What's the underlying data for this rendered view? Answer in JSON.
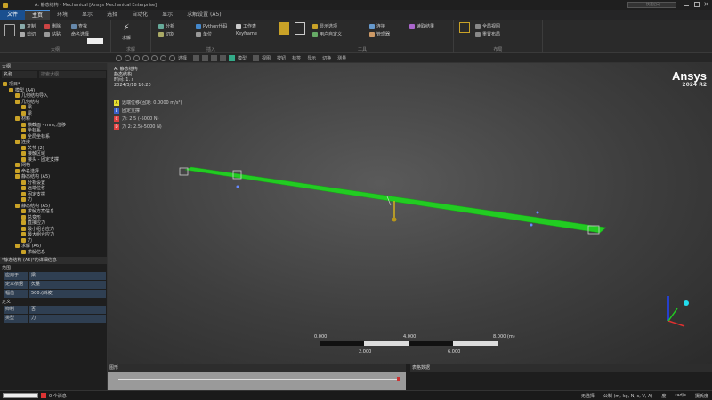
{
  "window": {
    "title": "A: 静态结构 - Mechanical [Ansys Mechanical Enterprise]",
    "search_placeholder": "快速启动"
  },
  "menu": {
    "file": "文件",
    "tabs": [
      "主页",
      "环境",
      "显示",
      "选择",
      "自动化",
      "显示",
      "求解设置 (A5)"
    ]
  },
  "ribbon": {
    "groups": [
      "大纲",
      "求解",
      "插入",
      "工具",
      "布局"
    ],
    "items": [
      "复制",
      "剪切",
      "删除",
      "粘贴",
      "查找",
      "命名选择",
      "求解",
      "分析",
      "切割",
      "Python代码",
      "单位",
      "工作表",
      "Keyframe",
      "显示选项",
      "用户自定义",
      "连接",
      "管理器",
      "读取结果",
      "全局视图",
      "重置布局"
    ]
  },
  "toolbar": {
    "labels": [
      "选择",
      "模型",
      "视图",
      "按钮",
      "标签",
      "显示",
      "切换",
      "测量"
    ]
  },
  "outline": {
    "header": "大纲",
    "filter_label": "名称",
    "search_placeholder": "搜索大纲",
    "items": [
      {
        "label": "项目*",
        "indent": 0
      },
      {
        "label": "模型 (A4)",
        "indent": 1
      },
      {
        "label": "几何结构导入",
        "indent": 2
      },
      {
        "label": "几何结构",
        "indent": 2
      },
      {
        "label": "梁",
        "indent": 3
      },
      {
        "label": "梁",
        "indent": 3
      },
      {
        "label": "材料",
        "indent": 2
      },
      {
        "label": "横截面 - mm,,位移",
        "indent": 3
      },
      {
        "label": "坐标系",
        "indent": 3
      },
      {
        "label": "全局坐标系",
        "indent": 3
      },
      {
        "label": "连接",
        "indent": 2
      },
      {
        "label": "关节 (2)",
        "indent": 3
      },
      {
        "label": "接触区域",
        "indent": 3
      },
      {
        "label": "接头 - 固定支撑",
        "indent": 3
      },
      {
        "label": "网格",
        "indent": 2
      },
      {
        "label": "命名选择",
        "indent": 2
      },
      {
        "label": "静态结构 (A5)",
        "indent": 2
      },
      {
        "label": "分析设置",
        "indent": 3
      },
      {
        "label": "远端位移",
        "indent": 3
      },
      {
        "label": "固定支撑",
        "indent": 3
      },
      {
        "label": "力",
        "indent": 3
      },
      {
        "label": "静态结构 (A5)",
        "indent": 2
      },
      {
        "label": "求解方案信息",
        "indent": 3
      },
      {
        "label": "总变形",
        "indent": 3
      },
      {
        "label": "直接应力",
        "indent": 3
      },
      {
        "label": "最小组合应力",
        "indent": 3
      },
      {
        "label": "最大组合应力",
        "indent": 3
      },
      {
        "label": "力",
        "indent": 3
      },
      {
        "label": "求解 (A6)",
        "indent": 2
      },
      {
        "label": "求解信息",
        "indent": 3
      }
    ]
  },
  "details": {
    "header": "\"静态结构 (A5)\"的详细信息",
    "sections": [
      {
        "title": "范围",
        "rows": [
          {
            "k": "应用于",
            "v": "梁"
          },
          {
            "k": "定义依据",
            "v": "矢量"
          },
          {
            "k": "幅值",
            "v": "500.(斜坡)"
          }
        ]
      },
      {
        "title": "定义",
        "rows": [
          {
            "k": "抑制",
            "v": "否"
          },
          {
            "k": "类型",
            "v": "力"
          }
        ]
      }
    ]
  },
  "viewport": {
    "title_lines": [
      "A: 静态结构",
      "静态结构",
      "时间: 1. s",
      "2024/3/18 10:23"
    ],
    "legend": [
      {
        "tag": "A",
        "label": "远端位移(固定: 0.0000 m/s²)",
        "color": "#e8e030"
      },
      {
        "tag": "B",
        "label": "固定支撑",
        "color": "#3a5fc8"
      },
      {
        "tag": "C",
        "label": "力: 2.5 (-5000 N)",
        "color": "#e04040"
      },
      {
        "tag": "D",
        "label": "力 2: 2.5(-5000 N)",
        "color": "#e04040"
      }
    ],
    "brand": "Ansys",
    "version": "2024 R2",
    "scale_top": [
      "0.000",
      "4.000",
      "8.000 (m)"
    ],
    "scale_bottom": [
      "2.000",
      "6.000"
    ]
  },
  "bottom": {
    "graph_label": "图形",
    "table_label": "表格数据"
  },
  "status": {
    "left": "0 个消息",
    "right": [
      "无选择",
      "公制 (m, kg, N, s, V, A)",
      "度",
      "rad/s",
      "摄氏度"
    ]
  },
  "colors": {
    "beam": "#22cc22",
    "accent": "#1a4f8f"
  }
}
